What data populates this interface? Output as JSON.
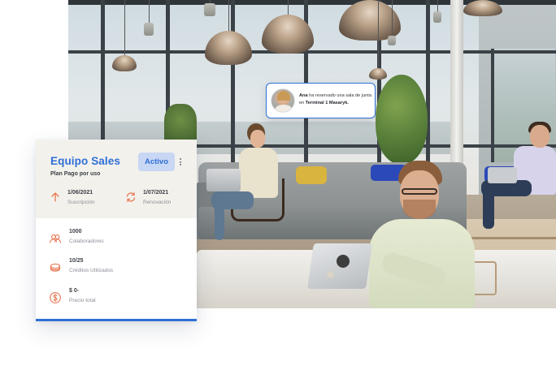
{
  "card": {
    "title": "Equipo Sales",
    "plan": "Plan Pago por uso",
    "status": "Activo",
    "dates": [
      {
        "value": "1/06/2021",
        "label": "Suscripción",
        "icon": "arrow-up-icon"
      },
      {
        "value": "1/07/2021",
        "label": "Renovación",
        "icon": "refresh-icon"
      }
    ],
    "stats": [
      {
        "value": "1000",
        "label": "Colaboradores",
        "icon": "people-icon"
      },
      {
        "value": "10/25",
        "label": "Créditos Utilizados",
        "icon": "coins-icon"
      },
      {
        "value": "$ 0-",
        "label": "Precio total",
        "icon": "dollar-circle-icon"
      }
    ]
  },
  "notification": {
    "name": "Ana",
    "message": "ha reservado una sala de junta en",
    "location": "Terminal 1 Masaryk."
  },
  "colors": {
    "accent": "#2f6fd6",
    "icon_orange": "#e8744f",
    "pill_bg": "#c8d7f3",
    "header_bg": "#f3f1ec"
  }
}
